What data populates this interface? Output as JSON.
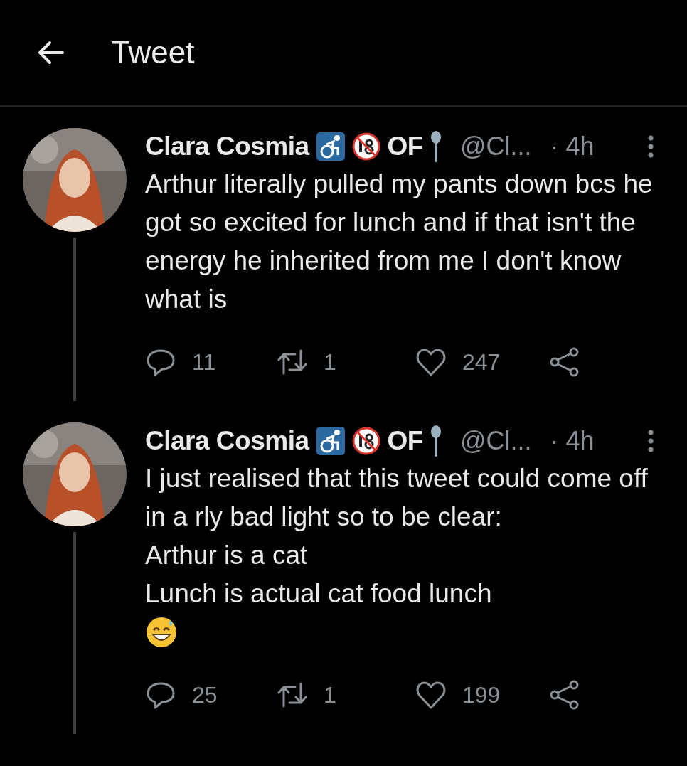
{
  "header": {
    "title": "Tweet"
  },
  "tweets": [
    {
      "name": "Clara Cosmia",
      "name_suffix": "OF",
      "handle": "@Cl...",
      "time": "· 4h",
      "lines": [
        "Arthur literally pulled my pants down bcs he got so excited for lunch and if that isn't the energy he inherited from me I don't know what is"
      ],
      "emoji_line": false,
      "replies": "11",
      "retweets": "1",
      "likes": "247",
      "thread_line": true
    },
    {
      "name": "Clara Cosmia",
      "name_suffix": "OF",
      "handle": "@Cl...",
      "time": "· 4h",
      "lines": [
        "I just realised that this tweet could come off in a rly bad light so to be clear:",
        "Arthur is a cat",
        "Lunch is actual cat food lunch"
      ],
      "emoji_line": true,
      "replies": "25",
      "retweets": "1",
      "likes": "199",
      "thread_line": true
    }
  ]
}
